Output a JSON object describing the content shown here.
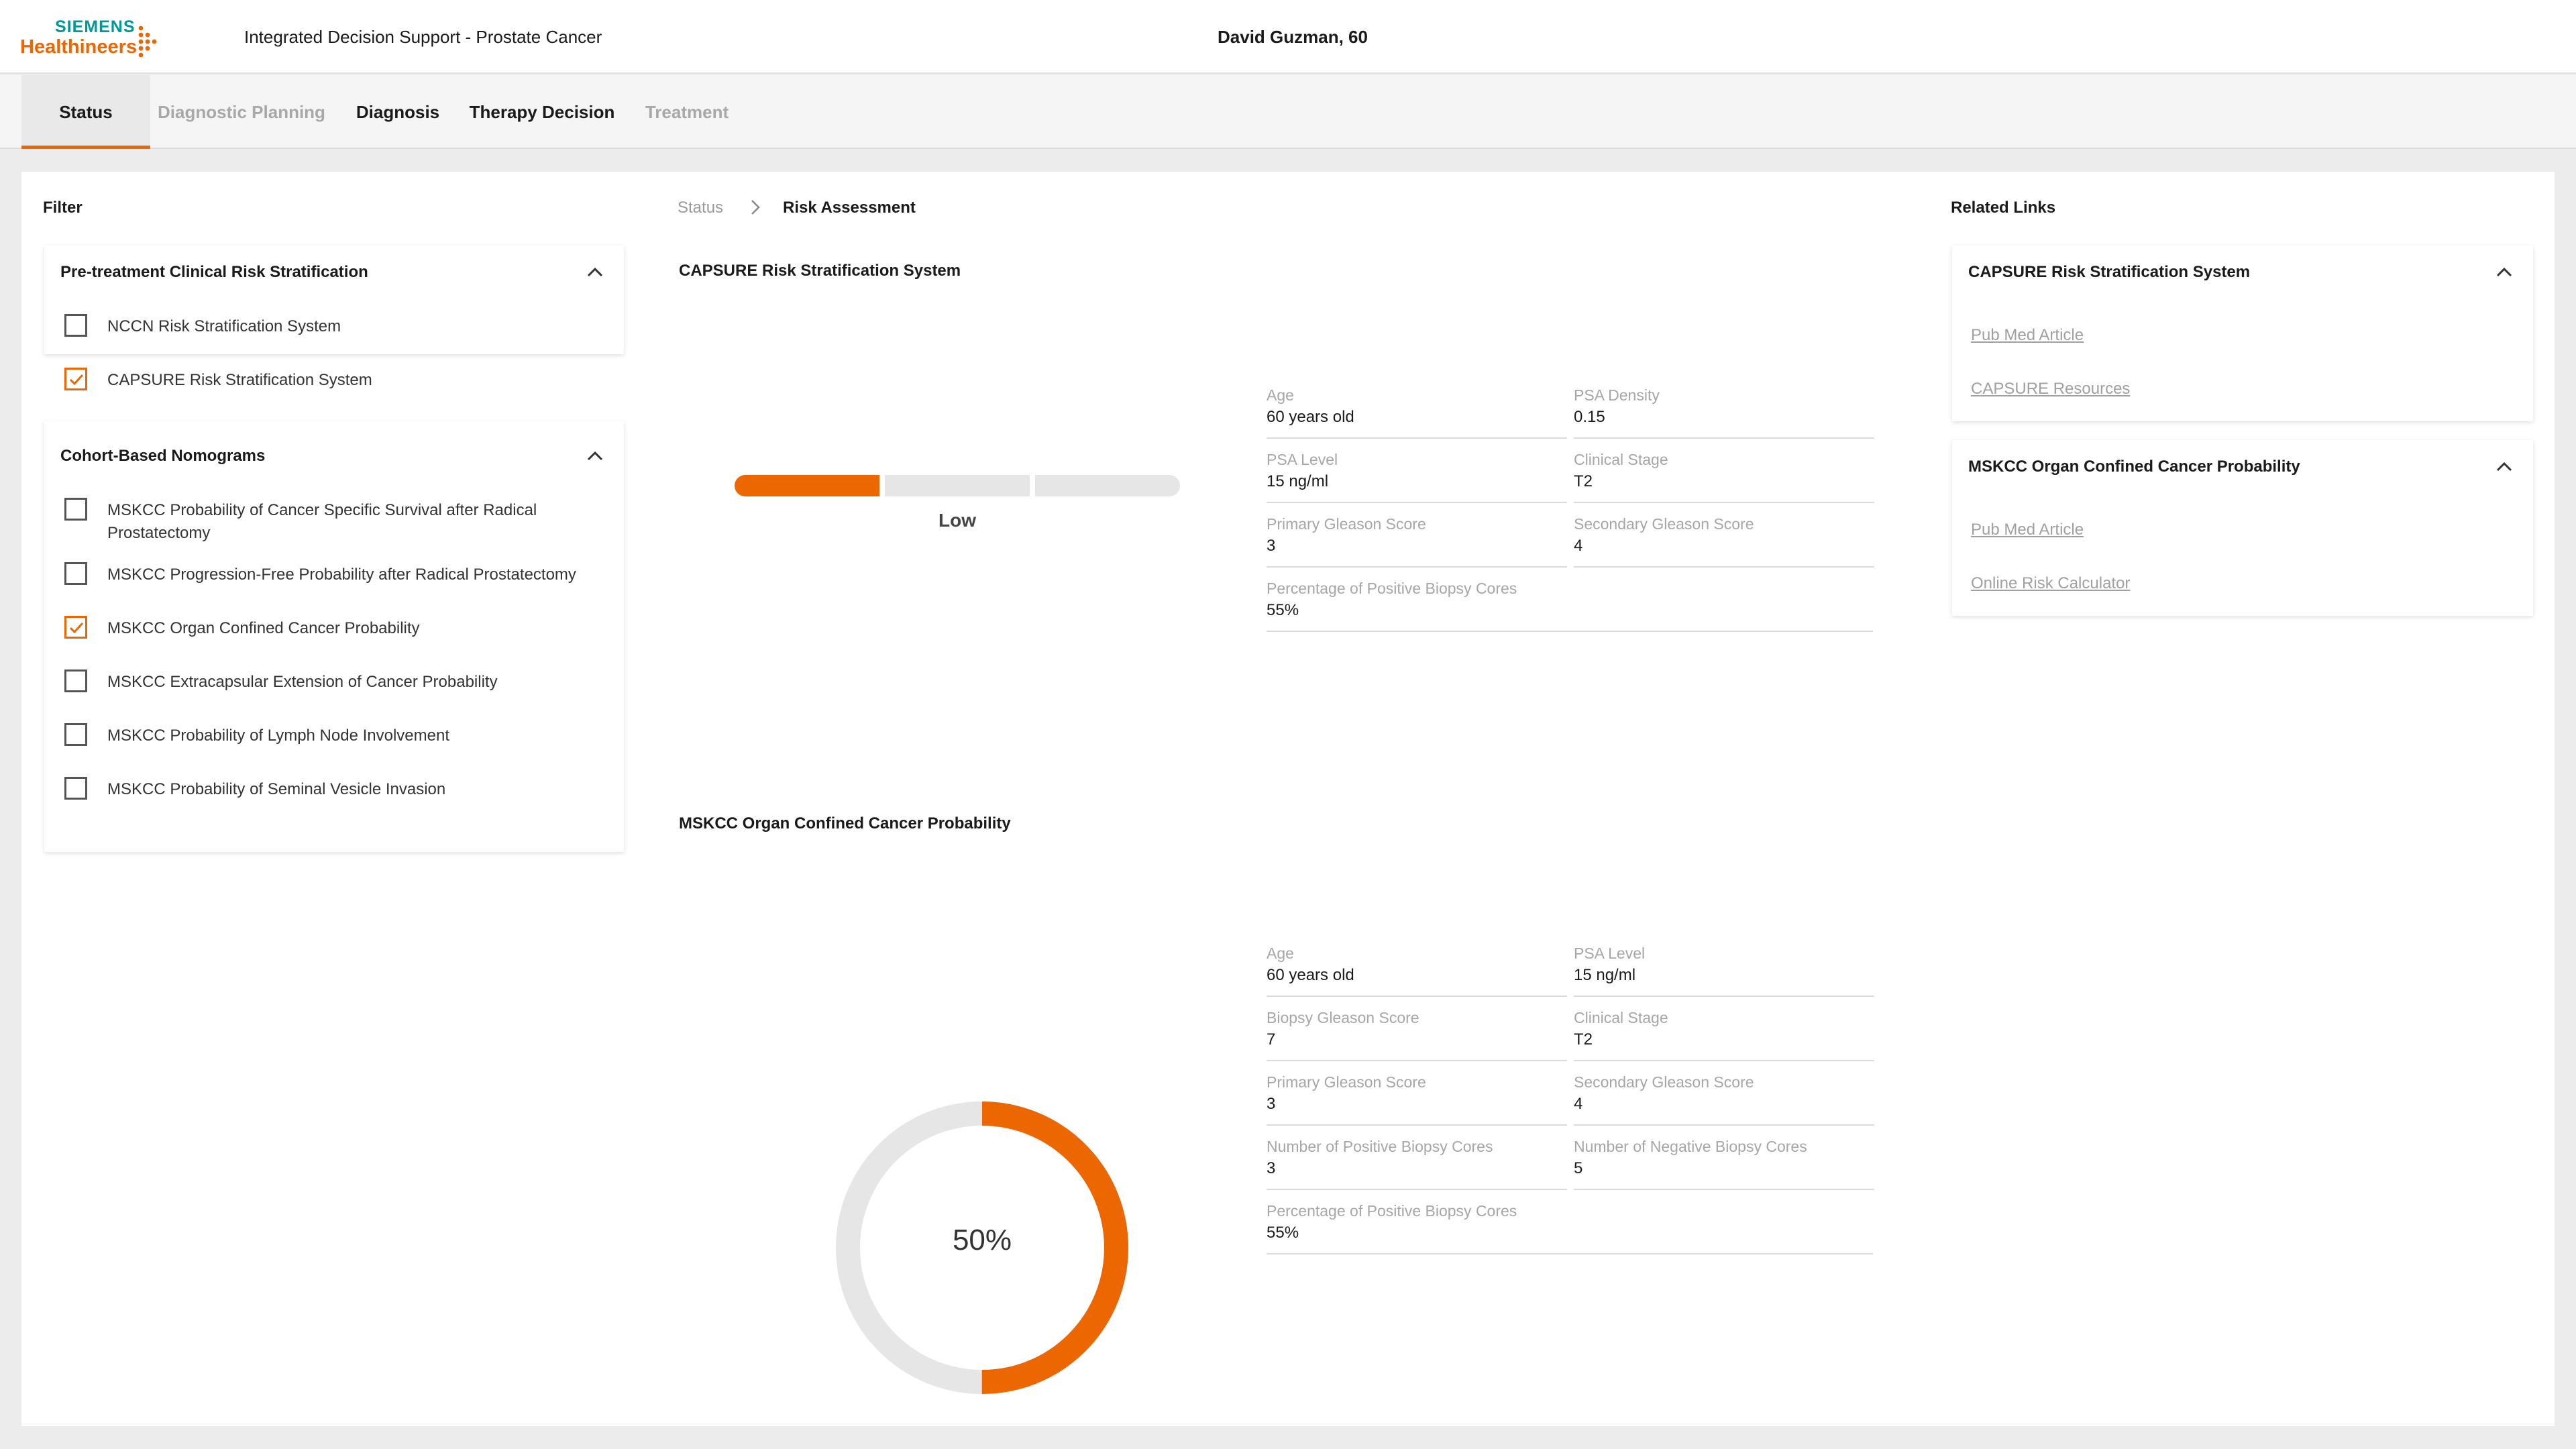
{
  "header": {
    "brand_line1": "SIEMENS",
    "brand_line2": "Healthineers",
    "app_title": "Integrated Decision Support - Prostate Cancer",
    "patient": "David Guzman, 60"
  },
  "tabs": [
    {
      "label": "Status",
      "state": "active"
    },
    {
      "label": "Diagnostic Planning",
      "state": "disabled"
    },
    {
      "label": "Diagnosis",
      "state": "normal"
    },
    {
      "label": "Therapy Decision",
      "state": "normal"
    },
    {
      "label": "Treatment",
      "state": "disabled"
    }
  ],
  "filter": {
    "title": "Filter",
    "groups": [
      {
        "title": "Pre-treatment Clinical Risk Stratification",
        "items": [
          {
            "label": "NCCN Risk Stratification System",
            "checked": false
          },
          {
            "label": "CAPSURE Risk Stratification System",
            "checked": true
          }
        ]
      },
      {
        "title": "Cohort-Based Nomograms",
        "items": [
          {
            "label": "MSKCC Probability of Cancer Specific Survival after Radical Prostatectomy",
            "checked": false
          },
          {
            "label": "MSKCC Progression-Free Probability after Radical Prostatectomy",
            "checked": false
          },
          {
            "label": "MSKCC Organ Confined Cancer Probability",
            "checked": true
          },
          {
            "label": "MSKCC Extracapsular Extension of Cancer Probability",
            "checked": false
          },
          {
            "label": "MSKCC Probability of Lymph Node Involvement",
            "checked": false
          },
          {
            "label": "MSKCC Probability of Seminal Vesicle Invasion",
            "checked": false
          }
        ]
      }
    ]
  },
  "breadcrumb": {
    "home": "Status",
    "current": "Risk Assessment"
  },
  "capsure": {
    "title": "CAPSURE Risk Stratification System",
    "risk_level": "Low",
    "risk_segments_filled": 1,
    "risk_segments_total": 3,
    "params": [
      {
        "label": "Age",
        "value": "60 years old"
      },
      {
        "label": "PSA Density",
        "value": "0.15"
      },
      {
        "label": "PSA Level",
        "value": "15 ng/ml"
      },
      {
        "label": "Clinical Stage",
        "value": "T2"
      },
      {
        "label": "Primary Gleason Score",
        "value": "3"
      },
      {
        "label": "Secondary Gleason Score",
        "value": "4"
      },
      {
        "label": "Percentage of Positive Biopsy Cores",
        "value": "55%"
      }
    ]
  },
  "mskcc": {
    "title": "MSKCC Organ Confined Cancer Probability",
    "probability_text": "50%",
    "probability": 0.5,
    "params": [
      {
        "label": "Age",
        "value": "60 years old"
      },
      {
        "label": "PSA Level",
        "value": "15 ng/ml"
      },
      {
        "label": "Biopsy Gleason Score",
        "value": "7"
      },
      {
        "label": "Clinical Stage",
        "value": "T2"
      },
      {
        "label": "Primary Gleason Score",
        "value": "3"
      },
      {
        "label": "Secondary Gleason Score",
        "value": "4"
      },
      {
        "label": "Number of Positive Biopsy Cores",
        "value": "3"
      },
      {
        "label": "Number of Negative Biopsy Cores",
        "value": "5"
      },
      {
        "label": "Percentage of Positive Biopsy Cores",
        "value": "55%"
      }
    ]
  },
  "related": {
    "title": "Related Links",
    "groups": [
      {
        "title": "CAPSURE Risk Stratification System",
        "links": [
          "Pub Med Article ",
          "CAPSURE Resources"
        ]
      },
      {
        "title": "MSKCC Organ Confined Cancer Probability",
        "links": [
          "Pub Med Article ",
          "Online Risk Calculator"
        ]
      }
    ]
  },
  "colors": {
    "accent": "#ec6602",
    "brand_teal": "#009999",
    "track": "#e6e6e6"
  }
}
